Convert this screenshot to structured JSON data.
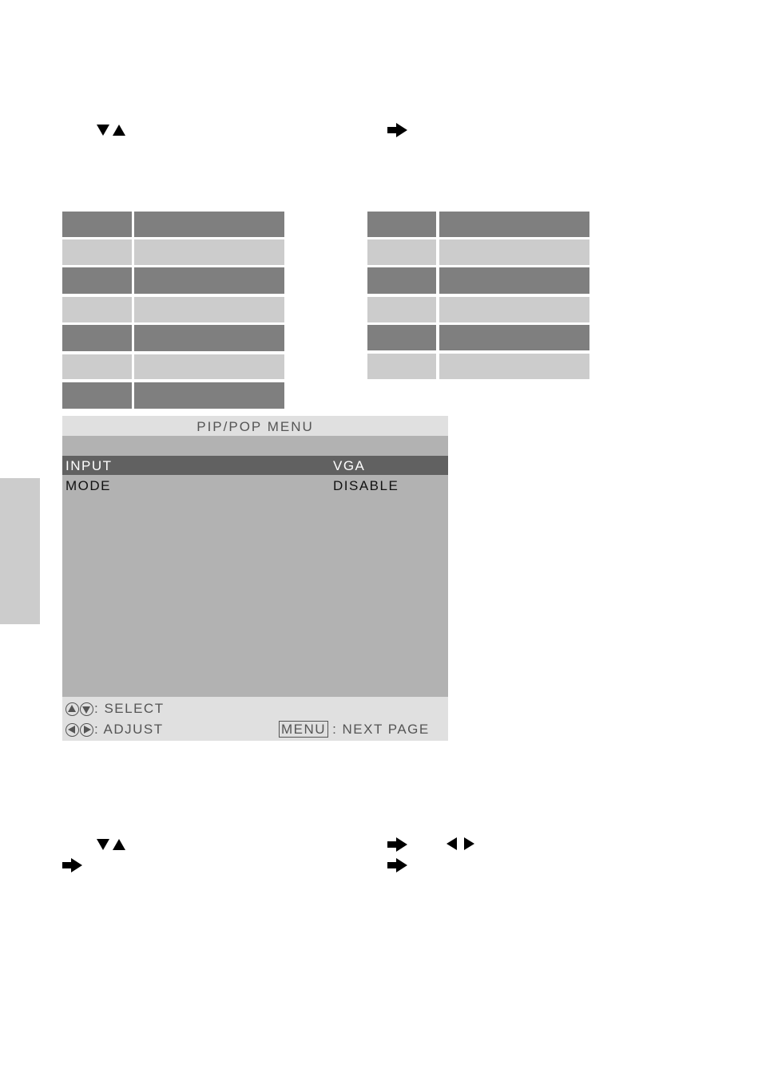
{
  "instructions_top": {
    "icons": [
      "down-triangle-icon",
      "up-triangle-icon",
      "right-arrow-icon"
    ]
  },
  "tables": {
    "left": {
      "rows": [
        {
          "shade": "dark",
          "key": "",
          "value": ""
        },
        {
          "shade": "light",
          "key": "",
          "value": ""
        },
        {
          "shade": "dark",
          "key": "",
          "value": ""
        },
        {
          "shade": "light",
          "key": "",
          "value": ""
        },
        {
          "shade": "dark",
          "key": "",
          "value": ""
        },
        {
          "shade": "light",
          "key": "",
          "value": ""
        },
        {
          "shade": "dark",
          "key": "",
          "value": ""
        }
      ]
    },
    "right": {
      "rows": [
        {
          "shade": "dark",
          "key": "",
          "value": ""
        },
        {
          "shade": "light",
          "key": "",
          "value": ""
        },
        {
          "shade": "dark",
          "key": "",
          "value": ""
        },
        {
          "shade": "light",
          "key": "",
          "value": ""
        },
        {
          "shade": "dark",
          "key": "",
          "value": ""
        },
        {
          "shade": "light",
          "key": "",
          "value": ""
        }
      ]
    }
  },
  "osd_menu": {
    "title": "PIP/POP MENU",
    "items": [
      {
        "label": "INPUT",
        "value": "VGA",
        "selected": true
      },
      {
        "label": "MODE",
        "value": "DISABLE",
        "selected": false
      }
    ],
    "footer": {
      "select_hint": ": SELECT",
      "adjust_hint": ": ADJUST",
      "menu_key": "MENU",
      "next_page_hint": ": NEXT PAGE"
    }
  },
  "colors": {
    "dark_row": "#7f7f7f",
    "light_row": "#cccccc",
    "osd_body": "#b2b2b2",
    "osd_header": "#e0e0e0",
    "osd_selected": "#616161"
  },
  "instructions_bottom": {
    "icons": [
      "down-triangle-icon",
      "up-triangle-icon",
      "right-arrow-icon",
      "left-triangle-icon",
      "right-triangle-icon",
      "right-arrow-icon",
      "right-arrow-icon"
    ]
  }
}
